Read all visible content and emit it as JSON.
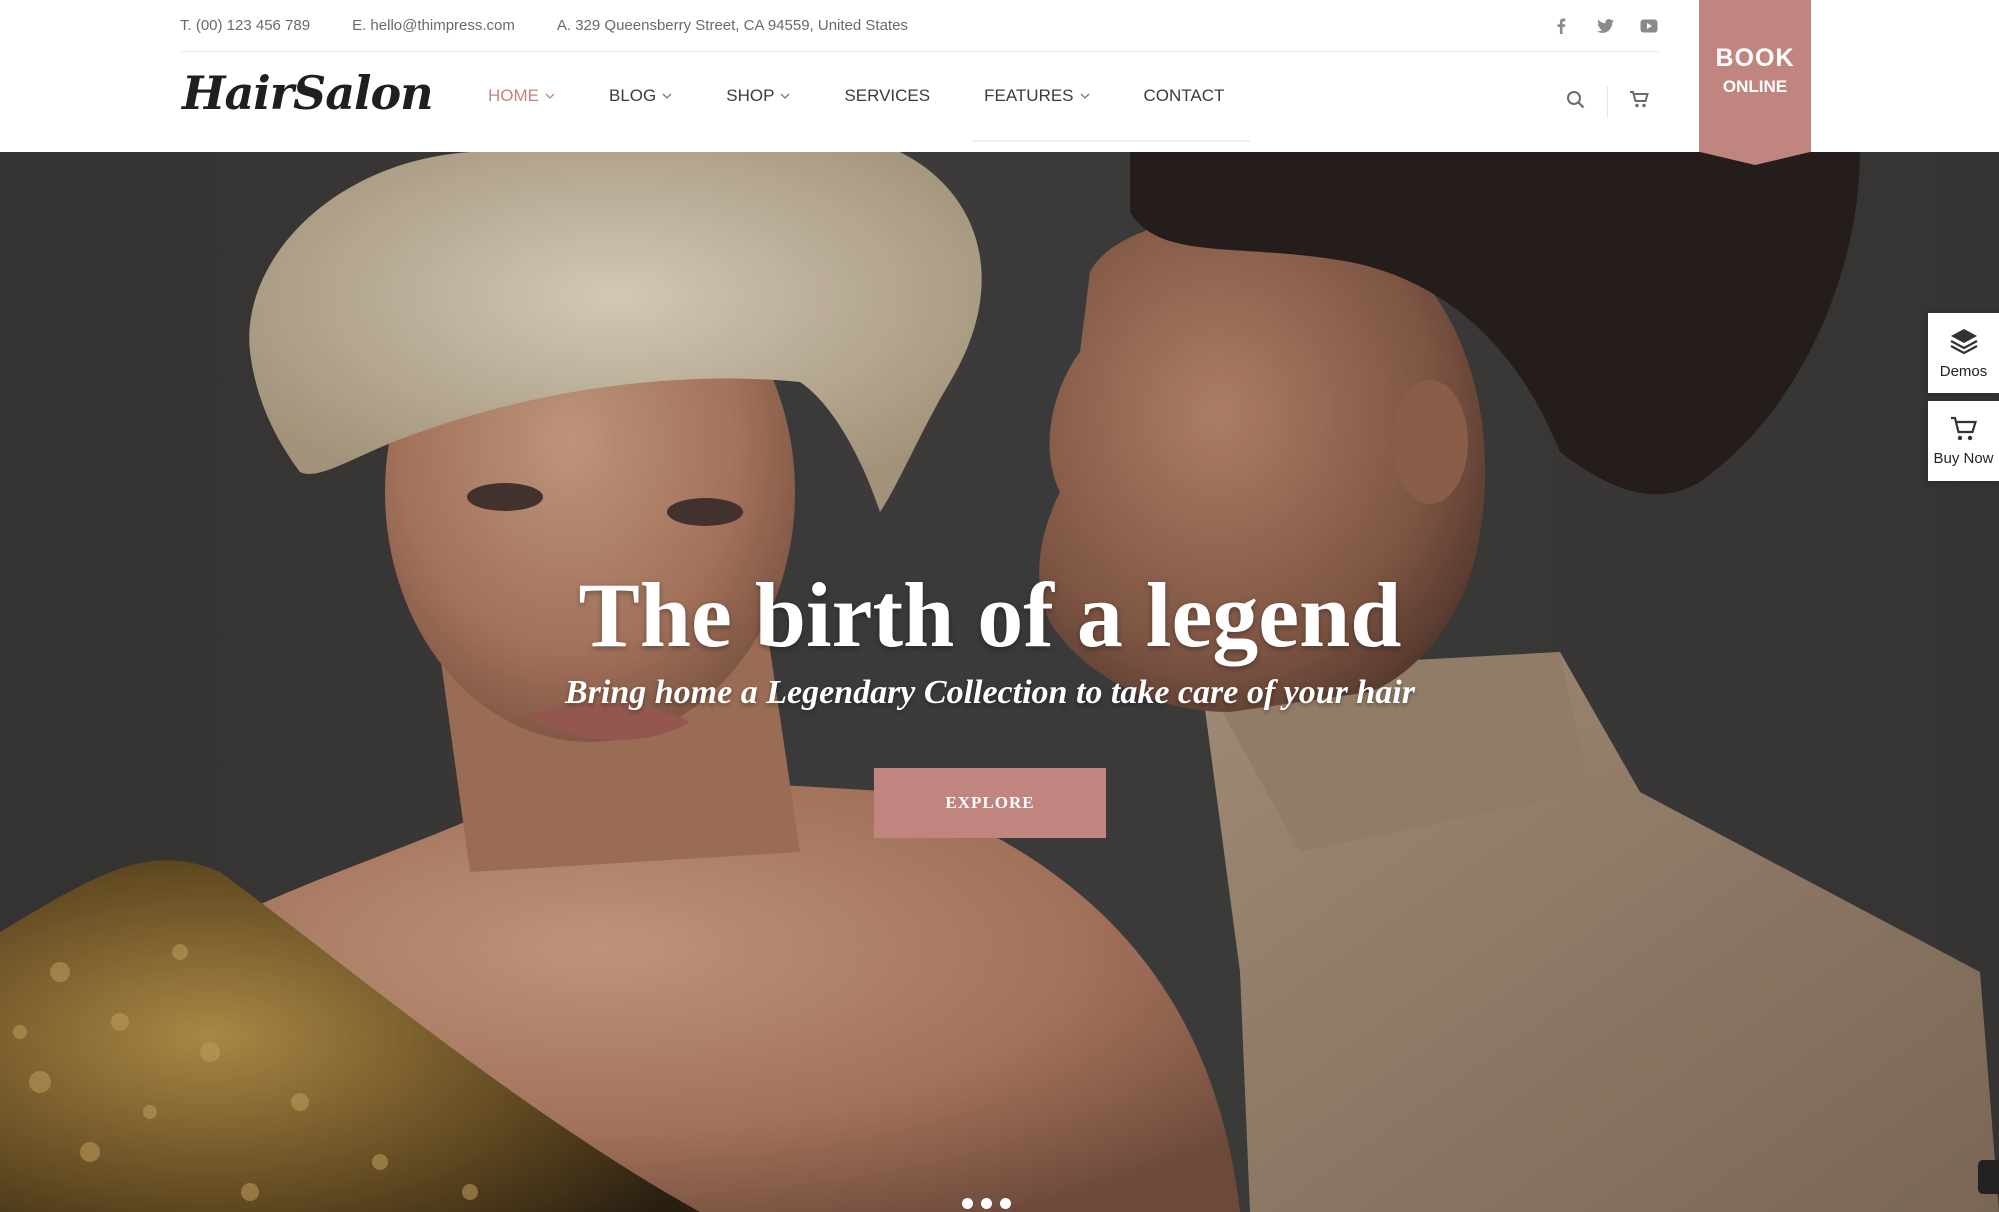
{
  "topbar": {
    "phone": "T. (00) 123 456 789",
    "email": "E. hello@thimpress.com",
    "address": "A. 329 Queensberry Street, CA 94559, United States",
    "social": [
      "facebook-icon",
      "twitter-icon",
      "youtube-icon"
    ]
  },
  "logo": "HairSalon",
  "nav": {
    "items": [
      {
        "label": "HOME",
        "dropdown": true,
        "active": true
      },
      {
        "label": "BLOG",
        "dropdown": true
      },
      {
        "label": "SHOP",
        "dropdown": true
      },
      {
        "label": "SERVICES",
        "dropdown": false
      },
      {
        "label": "FEATURES",
        "dropdown": true
      },
      {
        "label": "CONTACT",
        "dropdown": false
      }
    ]
  },
  "tools": {
    "search_icon": "search-icon",
    "cart_icon": "cart-icon"
  },
  "book": {
    "line1": "BOOK",
    "line2": "ONLINE"
  },
  "hero": {
    "headline": "The birth of a legend",
    "subline": "Bring home a Legendary Collection to take care of your hair",
    "cta": "EXPLORE",
    "slides": 3
  },
  "side": {
    "demos": "Demos",
    "buy_now": "Buy Now"
  },
  "colors": {
    "accent": "#c0857f",
    "text": "#333333",
    "hero_bg": "#414040"
  }
}
